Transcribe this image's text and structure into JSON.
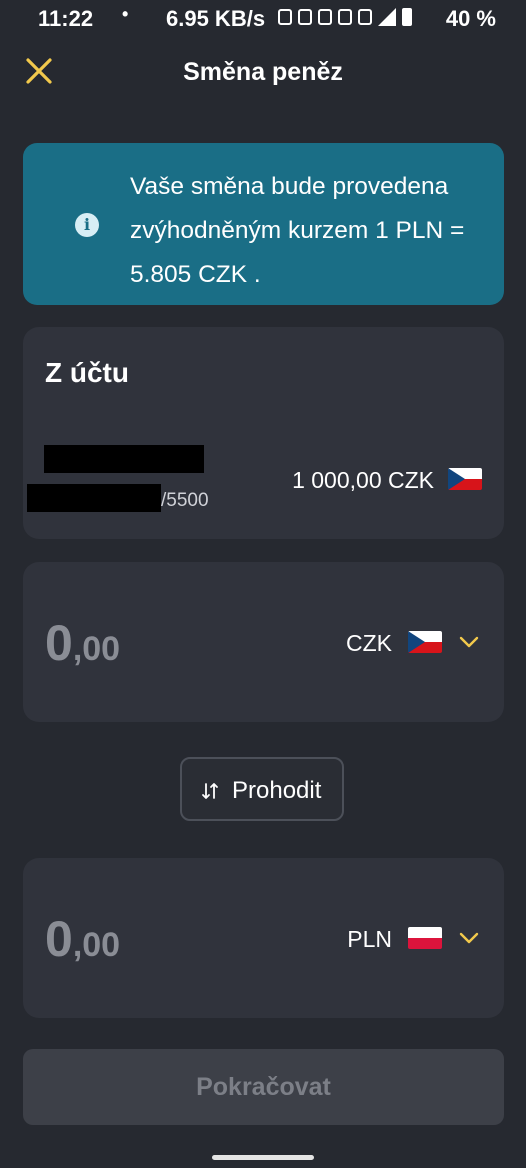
{
  "status_bar": {
    "time": "11:22",
    "dot": "•",
    "speed": "6.95 KB/s",
    "battery": "40 %"
  },
  "header": {
    "title": "Směna peněz",
    "close_icon": "close-icon"
  },
  "info_banner": {
    "text": "Vaše směna bude provedena zvýhodněným kurzem 1 PLN = 5.805 CZK .",
    "icon": "info-icon"
  },
  "from_account": {
    "title": "Z účtu",
    "account_suffix": "/5500",
    "balance": "1 000,00 CZK",
    "flag": "czech-flag"
  },
  "source_amount": {
    "int": "0",
    "dec": ",00",
    "currency": "CZK",
    "flag": "czech-flag"
  },
  "swap": {
    "label": "Prohodit",
    "icon": "swap-arrows-icon"
  },
  "target_amount": {
    "int": "0",
    "dec": ",00",
    "currency": "PLN",
    "flag": "polish-flag"
  },
  "continue": {
    "label": "Pokračovat"
  },
  "colors": {
    "background": "#262930",
    "card": "#30333c",
    "banner": "#1a6e86",
    "accent": "#f2c94c"
  }
}
